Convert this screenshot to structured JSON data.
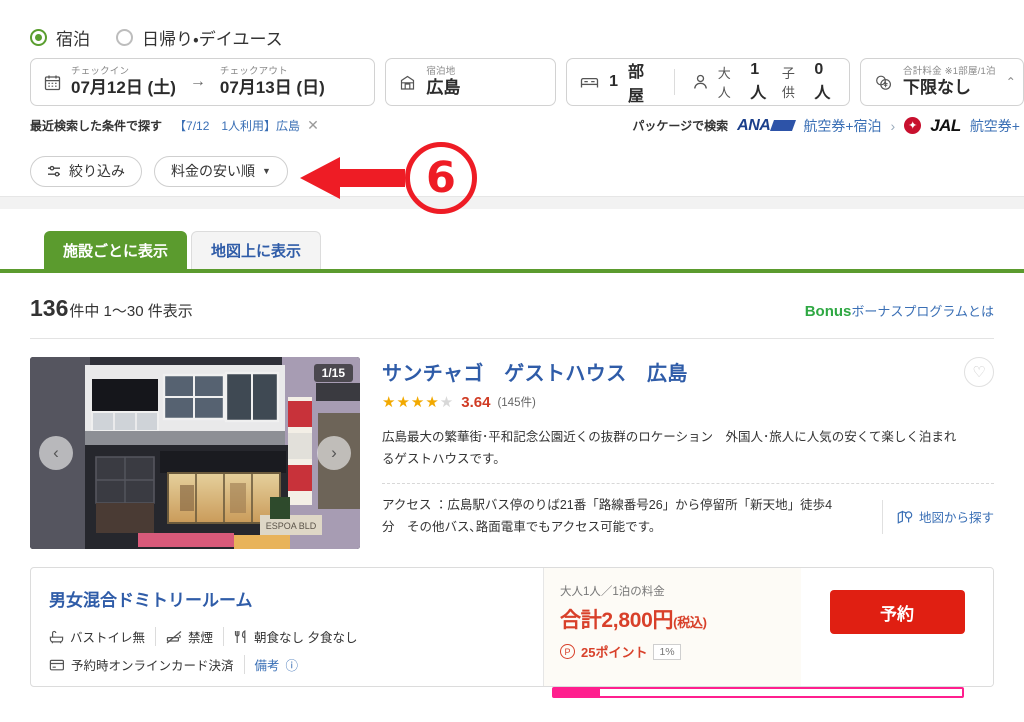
{
  "stay_type": {
    "options": [
      {
        "label": "宿泊",
        "selected": true
      },
      {
        "label": "日帰り・デイユース",
        "selected": false
      }
    ]
  },
  "search_bar": {
    "checkin": {
      "label": "チェックイン",
      "value": "07月12日 (土)",
      "icon": "calendar-icon"
    },
    "arrow": "→",
    "checkout": {
      "label": "チェックアウト",
      "value": "07月13日 (日)"
    },
    "destination": {
      "label": "宿泊地",
      "value": "広島",
      "icon": "building-icon"
    },
    "rooms": {
      "icon": "bed-icon",
      "count": "1",
      "unit": "部屋"
    },
    "guests": {
      "icon": "person-icon",
      "adult_label": "大人",
      "adult_count": "1人",
      "child_label": "子供",
      "child_count": "0人"
    },
    "price": {
      "label": "合計料金 ※1部屋/1泊",
      "value": "下限なし",
      "icon": "coins-icon",
      "caret": "⌃"
    }
  },
  "recent_search": {
    "label": "最近検索した条件で探す",
    "chip": "【7/12　1人利用】",
    "location": "広島",
    "close": "✕"
  },
  "package": {
    "label": "パッケージで検索",
    "ana": {
      "logo": "ANA",
      "link": "航空券+宿泊",
      "chevron": "›"
    },
    "jal": {
      "logo": "JAL",
      "link": "航空券+"
    }
  },
  "chips": {
    "filter": {
      "label": "絞り込み",
      "icon": "sliders-icon"
    },
    "sort": {
      "label": "料金の安い順",
      "caret": "▼"
    }
  },
  "annotation": {
    "number": "6",
    "color": "#ee1c25"
  },
  "tabs": [
    {
      "label": "施設ごとに表示",
      "active": true
    },
    {
      "label": "地図上に表示",
      "active": false
    }
  ],
  "results": {
    "total": "136",
    "rest": "件中 1〜30 件表示",
    "bonus_brand": "Bonus",
    "bonus_text": "ボーナスプログラムとは"
  },
  "hotel": {
    "name": "サンチャゴ　ゲストハウス　広島",
    "stars_filled": 4,
    "stars_total": 5,
    "score": "3.64",
    "review_count": "(145件)",
    "favorite_icon": "heart-icon",
    "photo": {
      "counter": "1/15",
      "prev": "‹",
      "next": "›",
      "sign_text": "ESPOA BLD"
    },
    "description": "広島最大の繁華街･平和記念公園近くの抜群のロケーション　外国人･旅人に人気の安くて楽しく泊まれるゲストハウスです。",
    "access": "アクセス ：広島駅バス停のりば21番「路線番号26」から停留所「新天地」徒歩4分　その他バス､路面電車でもアクセス可能です。",
    "map_link": "地図から探す",
    "map_icon": "map-pin-icon"
  },
  "room": {
    "title": "男女混合ドミトリールーム",
    "tags_line1": [
      {
        "icon": "bath-icon",
        "label": "バストイレ無"
      },
      {
        "icon": "no-smoking-icon",
        "label": "禁煙"
      },
      {
        "icon": "cutlery-icon",
        "label": "朝食なし 夕食なし"
      }
    ],
    "tags_line2": [
      {
        "icon": "card-icon",
        "label": "予約時オンラインカード決済"
      }
    ],
    "note_label": "備考",
    "note_icon": "info-icon",
    "price": {
      "label": "大人1人／1泊の料金",
      "total_prefix": "合計",
      "amount": "2,800円",
      "tax": "(税込)",
      "points": "25ポイント",
      "point_rate": "1%",
      "point_icon": "point-circle-icon"
    },
    "reserve_button": "予約"
  }
}
